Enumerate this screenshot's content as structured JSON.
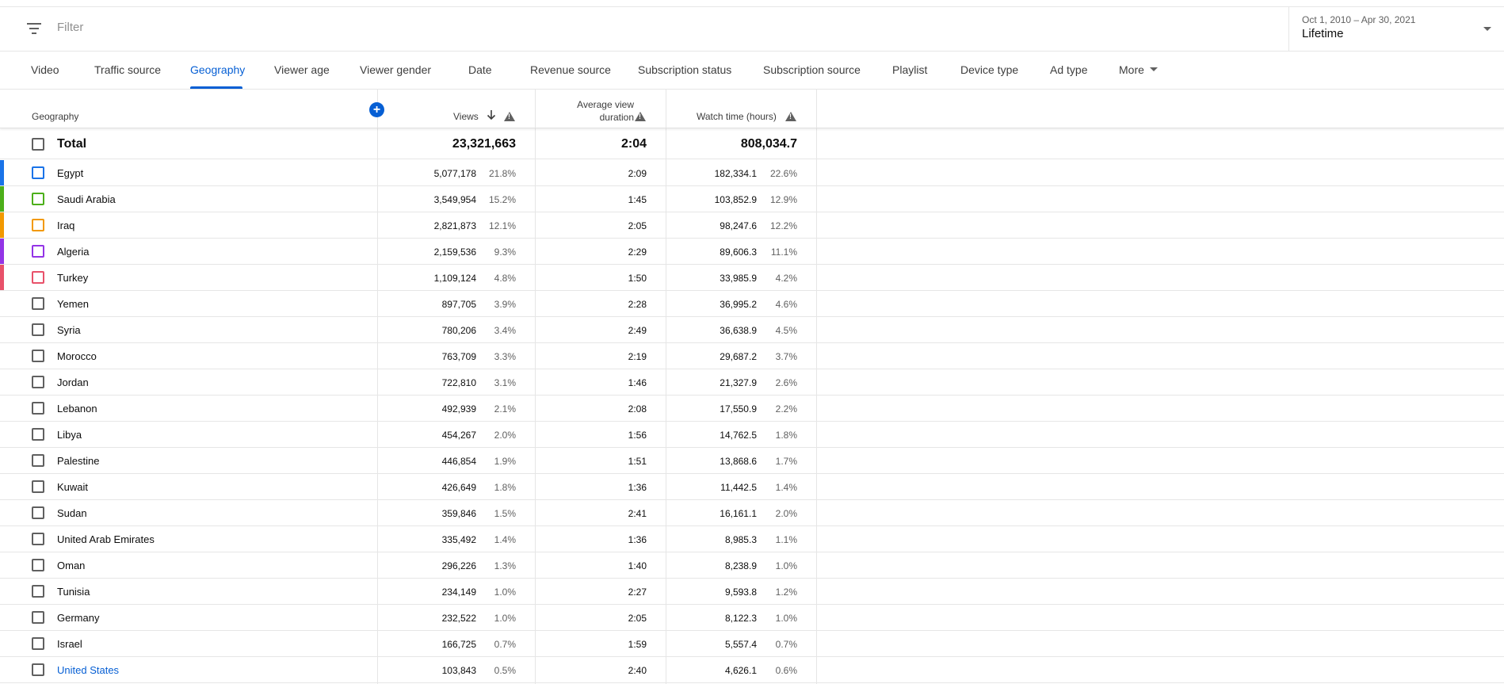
{
  "filter": {
    "placeholder": "Filter",
    "icon": "filter-icon"
  },
  "date_range": {
    "range": "Oct 1, 2010 – Apr 30, 2021",
    "preset": "Lifetime"
  },
  "tabs": [
    {
      "label": "Video",
      "active": false
    },
    {
      "label": "Traffic source",
      "active": false
    },
    {
      "label": "Geography",
      "active": true
    },
    {
      "label": "Viewer age",
      "active": false
    },
    {
      "label": "Viewer gender",
      "active": false
    },
    {
      "label": "Date",
      "active": false
    },
    {
      "label": "Revenue source",
      "active": false
    },
    {
      "label": "Subscription status",
      "active": false
    },
    {
      "label": "Subscription source",
      "active": false
    },
    {
      "label": "Playlist",
      "active": false
    },
    {
      "label": "Device type",
      "active": false
    },
    {
      "label": "Ad type",
      "active": false
    },
    {
      "label": "More",
      "active": false
    }
  ],
  "accent_color": "#065fd4",
  "table": {
    "headers": {
      "geography": "Geography",
      "views": "Views",
      "avg_line1": "Average view",
      "avg_line2": "duration",
      "watch_time": "Watch time (hours)"
    },
    "total": {
      "label": "Total",
      "views": "23,321,663",
      "avg": "2:04",
      "watch": "808,034.7"
    },
    "rows": [
      {
        "name": "Egypt",
        "views": "5,077,178",
        "views_pct": "21.8%",
        "avg": "2:09",
        "watch": "182,334.1",
        "watch_pct": "22.6%",
        "color": "#1a73e8"
      },
      {
        "name": "Saudi Arabia",
        "views": "3,549,954",
        "views_pct": "15.2%",
        "avg": "1:45",
        "watch": "103,852.9",
        "watch_pct": "12.9%",
        "color": "#4caf1a"
      },
      {
        "name": "Iraq",
        "views": "2,821,873",
        "views_pct": "12.1%",
        "avg": "2:05",
        "watch": "98,247.6",
        "watch_pct": "12.2%",
        "color": "#f29900"
      },
      {
        "name": "Algeria",
        "views": "2,159,536",
        "views_pct": "9.3%",
        "avg": "2:29",
        "watch": "89,606.3",
        "watch_pct": "11.1%",
        "color": "#9334e6"
      },
      {
        "name": "Turkey",
        "views": "1,109,124",
        "views_pct": "4.8%",
        "avg": "1:50",
        "watch": "33,985.9",
        "watch_pct": "4.2%",
        "color": "#e8516a"
      },
      {
        "name": "Yemen",
        "views": "897,705",
        "views_pct": "3.9%",
        "avg": "2:28",
        "watch": "36,995.2",
        "watch_pct": "4.6%",
        "color": null
      },
      {
        "name": "Syria",
        "views": "780,206",
        "views_pct": "3.4%",
        "avg": "2:49",
        "watch": "36,638.9",
        "watch_pct": "4.5%",
        "color": null
      },
      {
        "name": "Morocco",
        "views": "763,709",
        "views_pct": "3.3%",
        "avg": "2:19",
        "watch": "29,687.2",
        "watch_pct": "3.7%",
        "color": null
      },
      {
        "name": "Jordan",
        "views": "722,810",
        "views_pct": "3.1%",
        "avg": "1:46",
        "watch": "21,327.9",
        "watch_pct": "2.6%",
        "color": null
      },
      {
        "name": "Lebanon",
        "views": "492,939",
        "views_pct": "2.1%",
        "avg": "2:08",
        "watch": "17,550.9",
        "watch_pct": "2.2%",
        "color": null
      },
      {
        "name": "Libya",
        "views": "454,267",
        "views_pct": "2.0%",
        "avg": "1:56",
        "watch": "14,762.5",
        "watch_pct": "1.8%",
        "color": null
      },
      {
        "name": "Palestine",
        "views": "446,854",
        "views_pct": "1.9%",
        "avg": "1:51",
        "watch": "13,868.6",
        "watch_pct": "1.7%",
        "color": null
      },
      {
        "name": "Kuwait",
        "views": "426,649",
        "views_pct": "1.8%",
        "avg": "1:36",
        "watch": "11,442.5",
        "watch_pct": "1.4%",
        "color": null
      },
      {
        "name": "Sudan",
        "views": "359,846",
        "views_pct": "1.5%",
        "avg": "2:41",
        "watch": "16,161.1",
        "watch_pct": "2.0%",
        "color": null
      },
      {
        "name": "United Arab Emirates",
        "views": "335,492",
        "views_pct": "1.4%",
        "avg": "1:36",
        "watch": "8,985.3",
        "watch_pct": "1.1%",
        "color": null
      },
      {
        "name": "Oman",
        "views": "296,226",
        "views_pct": "1.3%",
        "avg": "1:40",
        "watch": "8,238.9",
        "watch_pct": "1.0%",
        "color": null
      },
      {
        "name": "Tunisia",
        "views": "234,149",
        "views_pct": "1.0%",
        "avg": "2:27",
        "watch": "9,593.8",
        "watch_pct": "1.2%",
        "color": null
      },
      {
        "name": "Germany",
        "views": "232,522",
        "views_pct": "1.0%",
        "avg": "2:05",
        "watch": "8,122.3",
        "watch_pct": "1.0%",
        "color": null
      },
      {
        "name": "Israel",
        "views": "166,725",
        "views_pct": "0.7%",
        "avg": "1:59",
        "watch": "5,557.4",
        "watch_pct": "0.7%",
        "color": null
      },
      {
        "name": "United States",
        "views": "103,843",
        "views_pct": "0.5%",
        "avg": "2:40",
        "watch": "4,626.1",
        "watch_pct": "0.6%",
        "color": null,
        "link": true
      }
    ]
  }
}
